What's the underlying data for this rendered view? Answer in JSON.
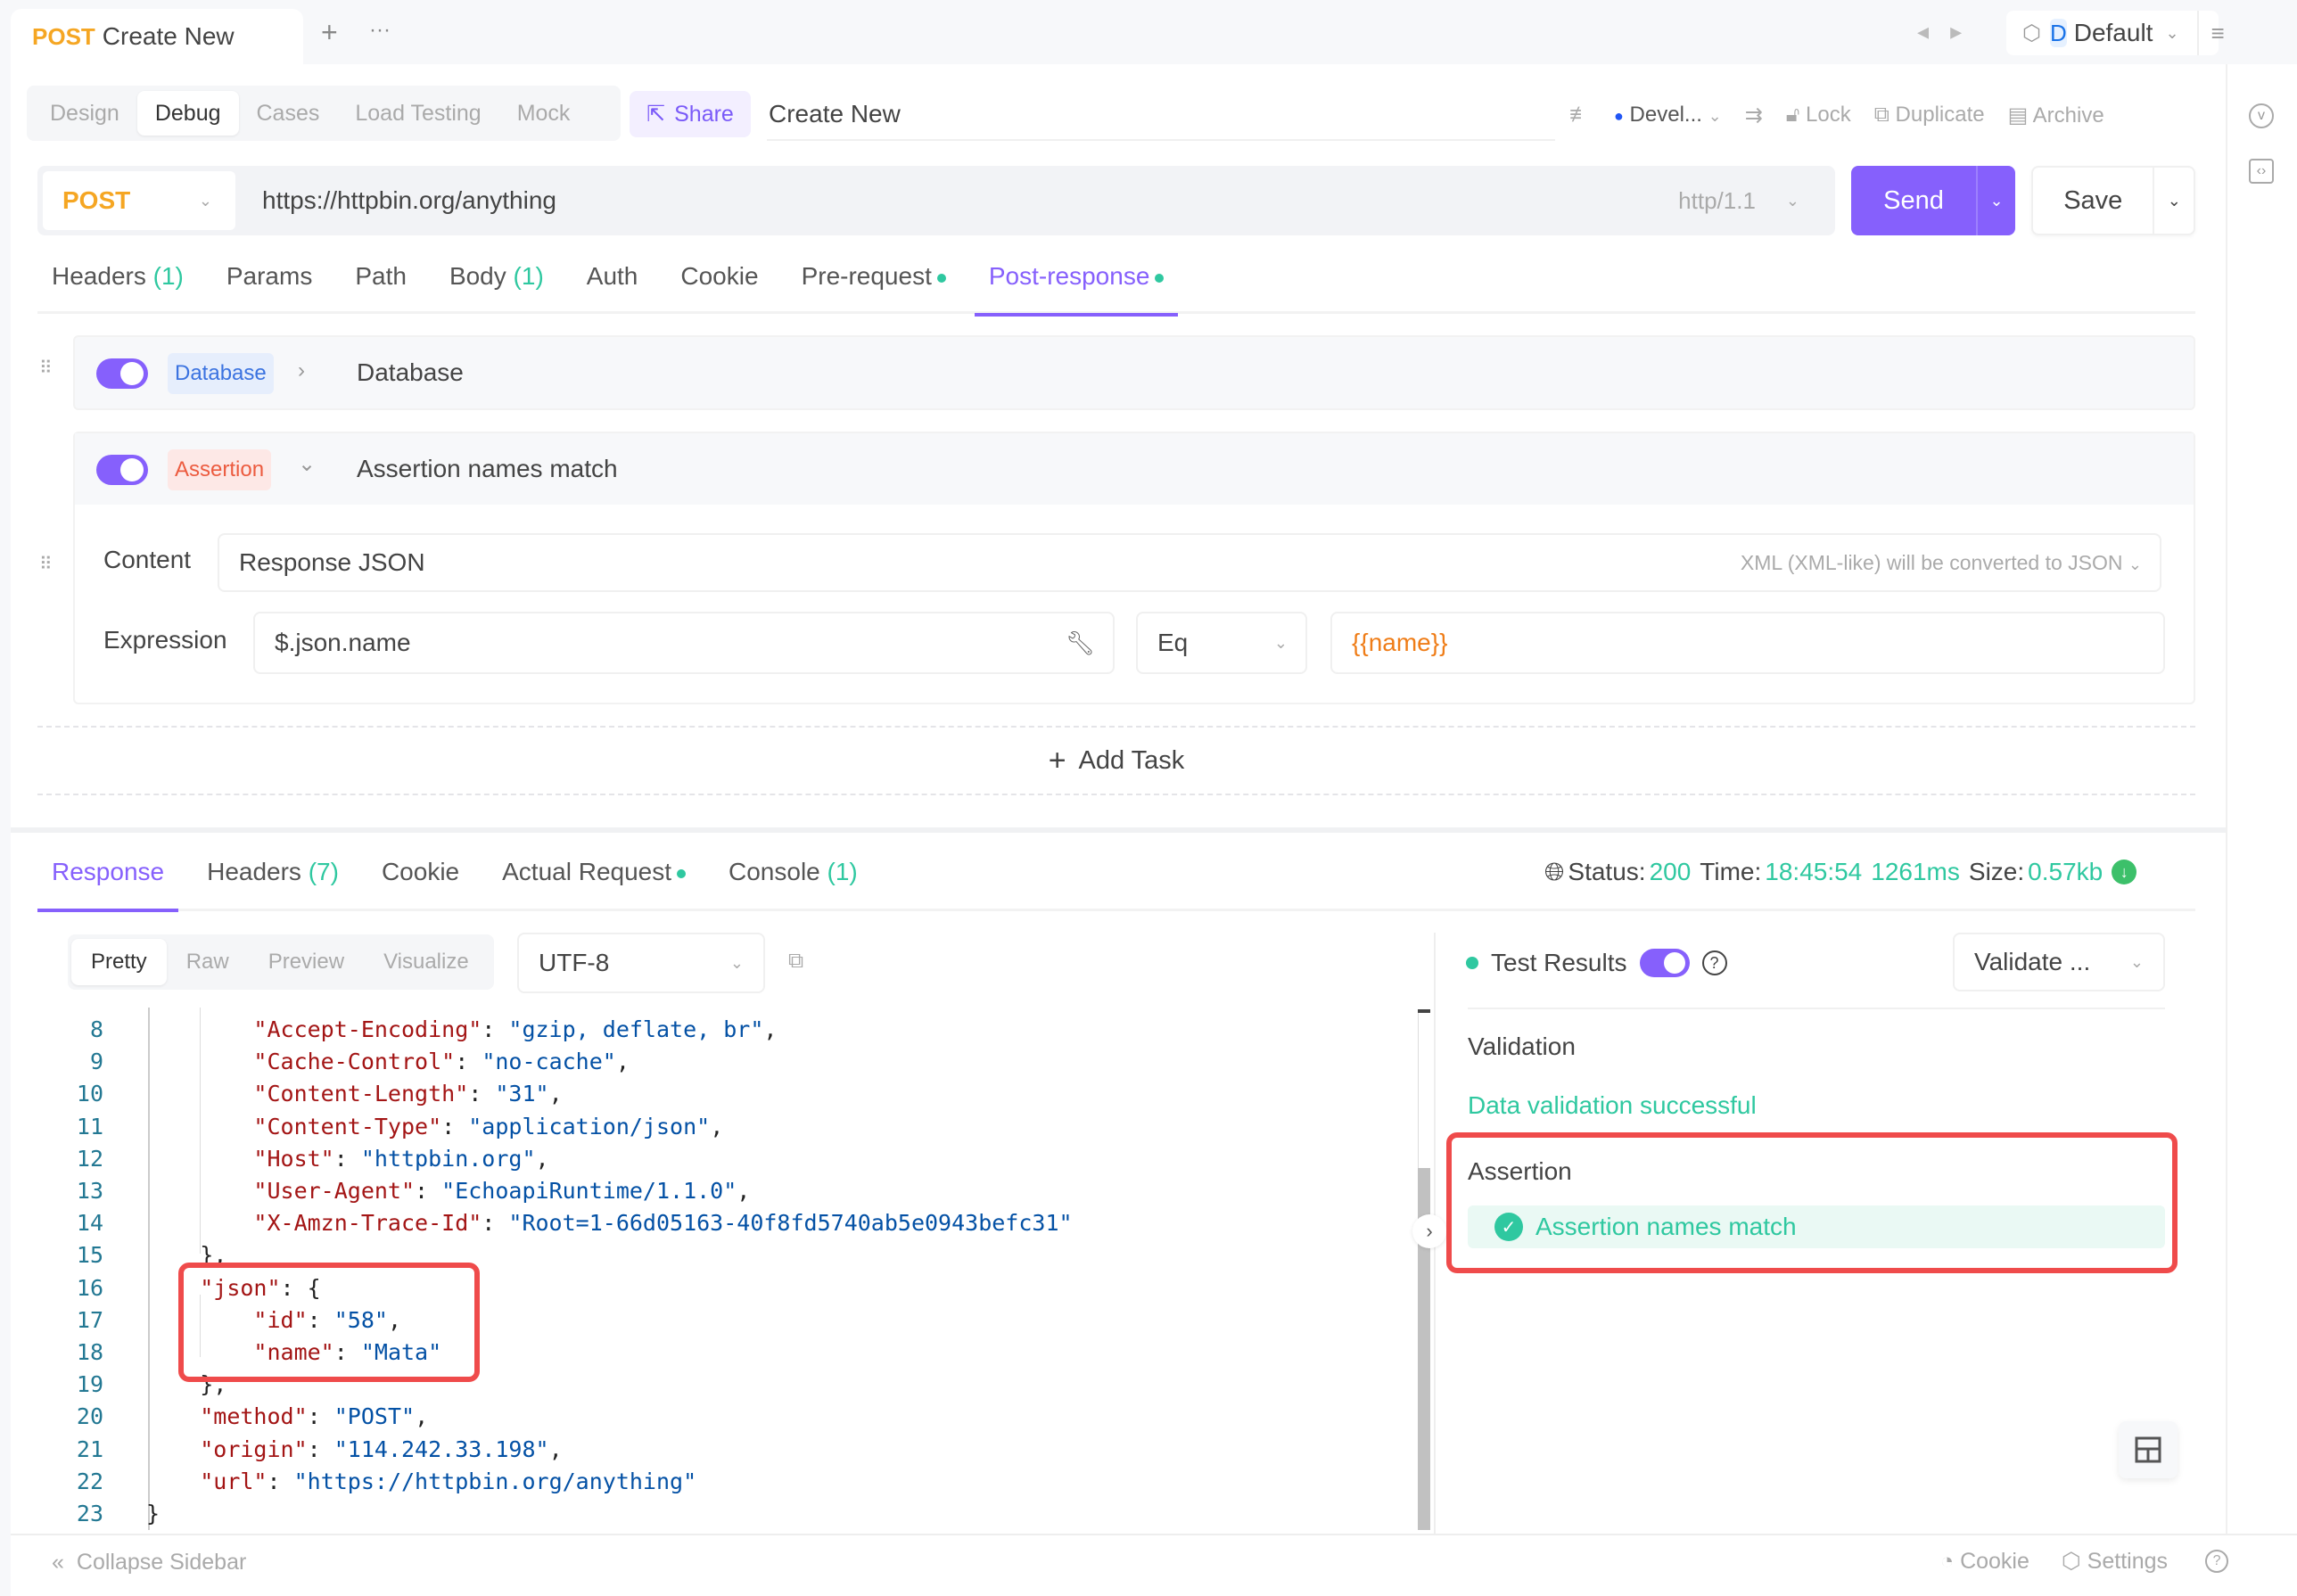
{
  "top_tab": {
    "method": "POST",
    "title": "Create New",
    "add_icon": "+",
    "more_icon": "···"
  },
  "environment": {
    "badge": "D",
    "name": "Default"
  },
  "mode_tabs": [
    {
      "label": "Design",
      "active": false
    },
    {
      "label": "Debug",
      "active": true
    },
    {
      "label": "Cases",
      "active": false
    },
    {
      "label": "Load Testing",
      "active": false
    },
    {
      "label": "Mock",
      "active": false
    }
  ],
  "share_label": "Share",
  "doc_name": "Create New",
  "actions": {
    "env_short": "Devel...",
    "lock": "Lock",
    "duplicate": "Duplicate",
    "archive": "Archive"
  },
  "request": {
    "method": "POST",
    "url": "https://httpbin.org/anything",
    "protocol": "http/1.1",
    "send": "Send",
    "save": "Save"
  },
  "request_tabs": [
    {
      "label": "Headers",
      "count": "(1)"
    },
    {
      "label": "Params"
    },
    {
      "label": "Path"
    },
    {
      "label": "Body",
      "count": "(1)"
    },
    {
      "label": "Auth"
    },
    {
      "label": "Cookie"
    },
    {
      "label": "Pre-request",
      "dot": true
    },
    {
      "label": "Post-response",
      "dot": true,
      "active": true
    }
  ],
  "tasks": [
    {
      "type": "Database",
      "name": "Database",
      "enabled": true,
      "expanded": false
    },
    {
      "type": "Assertion",
      "name": "Assertion names match",
      "enabled": true,
      "expanded": true,
      "content_label": "Content",
      "content_value": "Response JSON",
      "content_hint": "XML (XML-like) will be converted to JSON",
      "expression_label": "Expression",
      "expression_value": "$.json.name",
      "operator": "Eq",
      "expected": "{{name}}"
    }
  ],
  "add_task": "Add Task",
  "response_tabs": [
    {
      "label": "Response",
      "active": true
    },
    {
      "label": "Headers",
      "count": "(7)"
    },
    {
      "label": "Cookie"
    },
    {
      "label": "Actual Request",
      "dot": true
    },
    {
      "label": "Console",
      "count": "(1)"
    }
  ],
  "status": {
    "status_label": "Status:",
    "status": "200",
    "time_label": "Time:",
    "time": "18:45:54",
    "duration": "1261ms",
    "size_label": "Size:",
    "size": "0.57kb"
  },
  "view_tabs": [
    {
      "label": "Pretty",
      "active": true
    },
    {
      "label": "Raw"
    },
    {
      "label": "Preview"
    },
    {
      "label": "Visualize"
    }
  ],
  "encoding": "UTF-8",
  "code_lines": [
    {
      "n": "8",
      "indent": "        ",
      "key": "\"Accept-Encoding\"",
      "val": "\"gzip, deflate, br\"",
      "end": ","
    },
    {
      "n": "9",
      "indent": "        ",
      "key": "\"Cache-Control\"",
      "val": "\"no-cache\"",
      "end": ","
    },
    {
      "n": "10",
      "indent": "        ",
      "key": "\"Content-Length\"",
      "val": "\"31\"",
      "end": ","
    },
    {
      "n": "11",
      "indent": "        ",
      "key": "\"Content-Type\"",
      "val": "\"application/json\"",
      "end": ","
    },
    {
      "n": "12",
      "indent": "        ",
      "key": "\"Host\"",
      "val": "\"httpbin.org\"",
      "end": ","
    },
    {
      "n": "13",
      "indent": "        ",
      "key": "\"User-Agent\"",
      "val": "\"EchoapiRuntime/1.1.0\"",
      "end": ","
    },
    {
      "n": "14",
      "indent": "        ",
      "key": "\"X-Amzn-Trace-Id\"",
      "val": "\"Root=1-66d05163-40f8fd5740ab5e0943befc31\"",
      "end": ""
    },
    {
      "n": "15",
      "indent": "    ",
      "plain": "},"
    },
    {
      "n": "16",
      "indent": "    ",
      "key": "\"json\"",
      "plain_after": ": {"
    },
    {
      "n": "17",
      "indent": "        ",
      "key": "\"id\"",
      "val": "\"58\"",
      "end": ","
    },
    {
      "n": "18",
      "indent": "        ",
      "key": "\"name\"",
      "val": "\"Mata\"",
      "end": ""
    },
    {
      "n": "19",
      "indent": "    ",
      "plain": "},"
    },
    {
      "n": "20",
      "indent": "    ",
      "key": "\"method\"",
      "val": "\"POST\"",
      "end": ","
    },
    {
      "n": "21",
      "indent": "    ",
      "key": "\"origin\"",
      "val": "\"114.242.33.198\"",
      "end": ","
    },
    {
      "n": "22",
      "indent": "    ",
      "key": "\"url\"",
      "val": "\"https://httpbin.org/anything\"",
      "end": ""
    },
    {
      "n": "23",
      "indent": "",
      "plain": "}"
    }
  ],
  "test_results": {
    "title": "Test Results",
    "filter": "Validate ...",
    "validation_title": "Validation",
    "validation_msg": "Data validation successful",
    "assertion_title": "Assertion",
    "assertion_result": "Assertion names match"
  },
  "footer": {
    "collapse": "Collapse Sidebar",
    "cookie": "Cookie",
    "settings": "Settings"
  },
  "colors": {
    "accent": "#8660fc",
    "success": "#2fc8a0",
    "method_post": "#f5a623",
    "highlight": "#ef4b4b"
  }
}
